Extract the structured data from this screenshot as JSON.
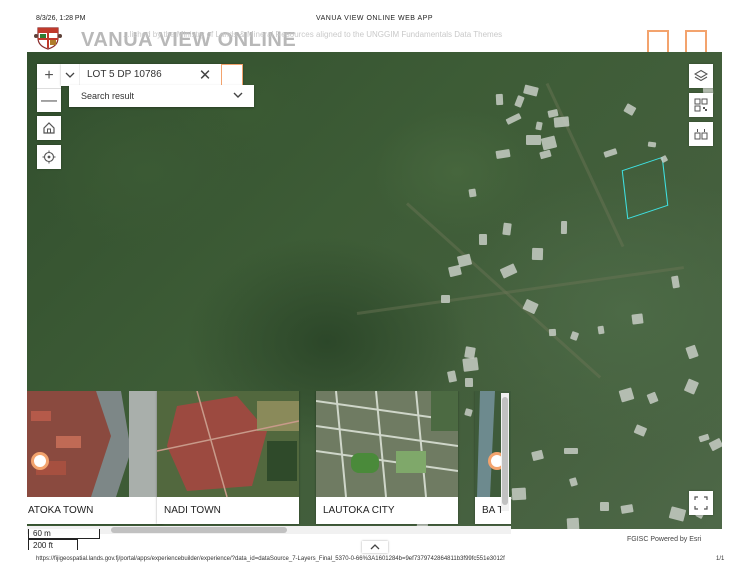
{
  "print_header": {
    "datetime": "8/3/26, 1:28 PM",
    "page_title": "VANUA VIEW ONLINE WEB APP"
  },
  "app": {
    "title": "VANUA VIEW ONLINE",
    "subtitle": "...lished by the Ministry of Lands & Mineral Resources aligned to the UNGGIM Fundamentals Data Themes"
  },
  "colors": {
    "accent": "#f3a36d",
    "parcel_outline": "#3fe0e0",
    "ui_bg": "#ffffff"
  },
  "map_controls": {
    "zoom_in": "+",
    "zoom_out": "—",
    "home_icon": "home-icon",
    "locate_icon": "locate-icon",
    "right_tools": [
      "layers-icon",
      "qr-code-icon",
      "basemap-icon"
    ]
  },
  "search": {
    "value": "LOT 5 DP 10786",
    "clear": "✕",
    "results_label": "Search result"
  },
  "gallery": {
    "items": [
      {
        "label": "ATOKA TOWN"
      },
      {
        "label": "NADI TOWN"
      },
      {
        "label": "LAUTOKA CITY"
      },
      {
        "label": "BA T"
      }
    ]
  },
  "scalebar": {
    "metric": "60 m",
    "imperial": "200 ft"
  },
  "attribution": "FGISC   Powered by Esri",
  "print_footer": {
    "url": "https://fijigeospatial.lands.gov.fj/portal/apps/experiencebuilder/experience/?data_id=dataSource_7-Layers_Final_5370-0-66%3A1601284b=9ef7379742864811b3f99fc551e3012f",
    "page": "1/1"
  }
}
